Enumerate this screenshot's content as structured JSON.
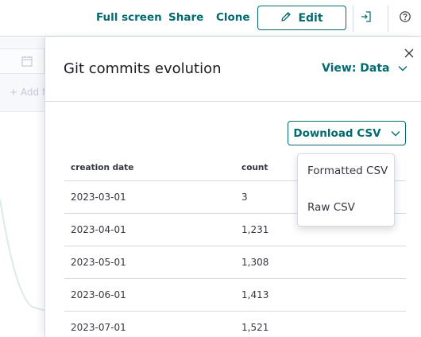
{
  "toolbar": {
    "full_screen": "Full screen",
    "share": "Share",
    "clone": "Clone",
    "edit": "Edit"
  },
  "background": {
    "add_filter": "+ Add fi"
  },
  "flyout": {
    "title": "Git commits evolution",
    "view_label": "View: Data",
    "download_label": "Download CSV",
    "download_options": [
      "Formatted CSV",
      "Raw CSV"
    ]
  },
  "table": {
    "headers": [
      "creation date",
      "count"
    ],
    "rows": [
      [
        "2023-03-01",
        "3"
      ],
      [
        "2023-04-01",
        "1,231"
      ],
      [
        "2023-05-01",
        "1,308"
      ],
      [
        "2023-06-01",
        "1,413"
      ],
      [
        "2023-07-01",
        "1,521"
      ]
    ]
  },
  "colors": {
    "accent": "#006b70",
    "border": "#d3dae6",
    "text": "#343741"
  }
}
